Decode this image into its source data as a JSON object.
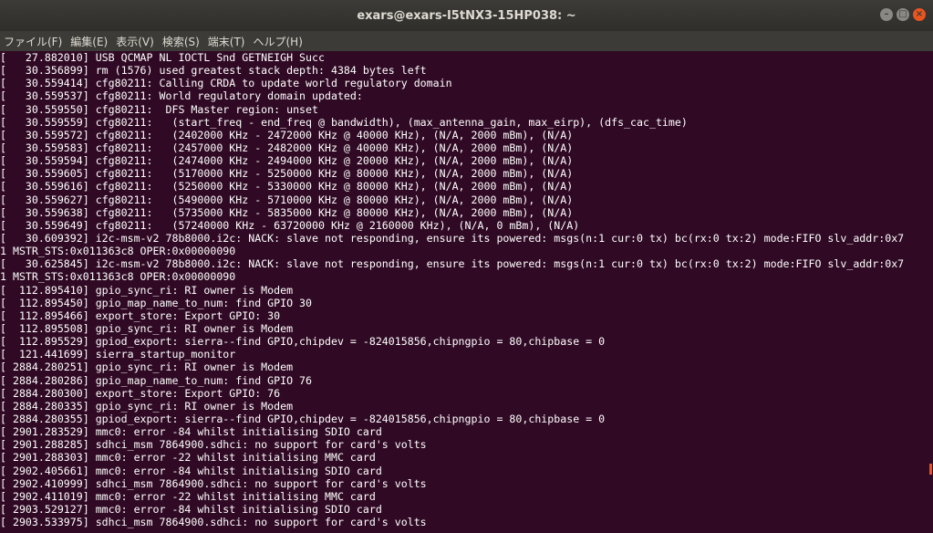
{
  "window": {
    "title": "exars@exars-I5tNX3-15HP038: ~"
  },
  "menu": [
    "ファイル(F)",
    "編集(E)",
    "表示(V)",
    "検索(S)",
    "端末(T)",
    "ヘルプ(H)"
  ],
  "lines": [
    "[   27.882010] USB QCMAP NL IOCTL Snd GETNEIGH Succ",
    "[   30.356899] rm (1576) used greatest stack depth: 4384 bytes left",
    "[   30.559414] cfg80211: Calling CRDA to update world regulatory domain",
    "[   30.559537] cfg80211: World regulatory domain updated:",
    "[   30.559550] cfg80211:  DFS Master region: unset",
    "[   30.559559] cfg80211:   (start_freq - end_freq @ bandwidth), (max_antenna_gain, max_eirp), (dfs_cac_time)",
    "[   30.559572] cfg80211:   (2402000 KHz - 2472000 KHz @ 40000 KHz), (N/A, 2000 mBm), (N/A)",
    "[   30.559583] cfg80211:   (2457000 KHz - 2482000 KHz @ 40000 KHz), (N/A, 2000 mBm), (N/A)",
    "[   30.559594] cfg80211:   (2474000 KHz - 2494000 KHz @ 20000 KHz), (N/A, 2000 mBm), (N/A)",
    "[   30.559605] cfg80211:   (5170000 KHz - 5250000 KHz @ 80000 KHz), (N/A, 2000 mBm), (N/A)",
    "[   30.559616] cfg80211:   (5250000 KHz - 5330000 KHz @ 80000 KHz), (N/A, 2000 mBm), (N/A)",
    "[   30.559627] cfg80211:   (5490000 KHz - 5710000 KHz @ 80000 KHz), (N/A, 2000 mBm), (N/A)",
    "[   30.559638] cfg80211:   (5735000 KHz - 5835000 KHz @ 80000 KHz), (N/A, 2000 mBm), (N/A)",
    "[   30.559649] cfg80211:   (57240000 KHz - 63720000 KHz @ 2160000 KHz), (N/A, 0 mBm), (N/A)",
    "[   30.609392] i2c-msm-v2 78b8000.i2c: NACK: slave not responding, ensure its powered: msgs(n:1 cur:0 tx) bc(rx:0 tx:2) mode:FIFO slv_addr:0x7",
    "1 MSTR_STS:0x011363c8 OPER:0x00000090",
    "[   30.625845] i2c-msm-v2 78b8000.i2c: NACK: slave not responding, ensure its powered: msgs(n:1 cur:0 tx) bc(rx:0 tx:2) mode:FIFO slv_addr:0x7",
    "1 MSTR_STS:0x011363c8 OPER:0x00000090",
    "[  112.895410] gpio_sync_ri: RI owner is Modem",
    "[  112.895450] gpio_map_name_to_num: find GPIO 30",
    "[  112.895466] export_store: Export GPIO: 30",
    "[  112.895508] gpio_sync_ri: RI owner is Modem",
    "[  112.895529] gpiod_export: sierra--find GPIO,chipdev = -824015856,chipngpio = 80,chipbase = 0",
    "[  121.441699] sierra_startup_monitor",
    "[ 2884.280251] gpio_sync_ri: RI owner is Modem",
    "[ 2884.280286] gpio_map_name_to_num: find GPIO 76",
    "[ 2884.280300] export_store: Export GPIO: 76",
    "[ 2884.280335] gpio_sync_ri: RI owner is Modem",
    "[ 2884.280355] gpiod_export: sierra--find GPIO,chipdev = -824015856,chipngpio = 80,chipbase = 0",
    "[ 2901.283529] mmc0: error -84 whilst initialising SDIO card",
    "[ 2901.288285] sdhci_msm 7864900.sdhci: no support for card's volts",
    "[ 2901.288303] mmc0: error -22 whilst initialising MMC card",
    "[ 2902.405661] mmc0: error -84 whilst initialising SDIO card",
    "[ 2902.410999] sdhci_msm 7864900.sdhci: no support for card's volts",
    "[ 2902.411019] mmc0: error -22 whilst initialising MMC card",
    "[ 2903.529127] mmc0: error -84 whilst initialising SDIO card",
    "[ 2903.533975] sdhci_msm 7864900.sdhci: no support for card's volts"
  ],
  "colors": {
    "terminal_bg": "#300a24",
    "text": "#ffffff",
    "accent": "#e95420",
    "titlebar": "#3c3b37"
  }
}
